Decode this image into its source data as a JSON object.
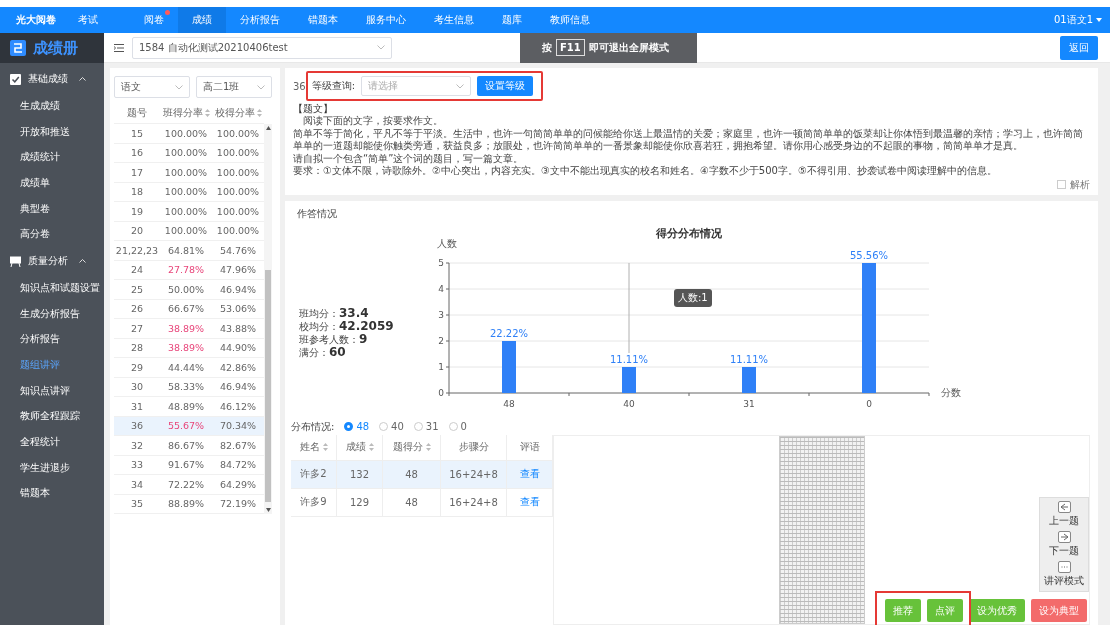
{
  "top_nav": {
    "brand": "光大阅卷",
    "items": [
      {
        "label": "考试",
        "selected": false,
        "dot": false
      },
      {
        "label": "阅卷",
        "selected": false,
        "dot": true
      },
      {
        "label": "成绩",
        "selected": true,
        "dot": false
      },
      {
        "label": "分析报告",
        "selected": false,
        "dot": false
      },
      {
        "label": "错题本",
        "selected": false,
        "dot": false
      },
      {
        "label": "服务中心",
        "selected": false,
        "dot": false
      },
      {
        "label": "考生信息",
        "selected": false,
        "dot": false
      },
      {
        "label": "题库",
        "selected": false,
        "dot": false
      },
      {
        "label": "教师信息",
        "selected": false,
        "dot": false
      }
    ],
    "user": "01语文1"
  },
  "sidebar": {
    "title": "成绩册",
    "groups": [
      {
        "label": "基础成绩",
        "expanded": true,
        "children": [
          {
            "label": "生成成绩",
            "selected": false
          },
          {
            "label": "开放和推送",
            "selected": false
          },
          {
            "label": "成绩统计",
            "selected": false
          },
          {
            "label": "成绩单",
            "selected": false
          },
          {
            "label": "典型卷",
            "selected": false
          },
          {
            "label": "高分卷",
            "selected": false
          }
        ]
      },
      {
        "label": "质量分析",
        "expanded": true,
        "children": [
          {
            "label": "知识点和试题设置",
            "selected": false
          },
          {
            "label": "生成分析报告",
            "selected": false
          },
          {
            "label": "分析报告",
            "selected": false
          },
          {
            "label": "题组讲评",
            "selected": true
          },
          {
            "label": "知识点讲评",
            "selected": false
          },
          {
            "label": "教师全程跟踪",
            "selected": false
          },
          {
            "label": "全程统计",
            "selected": false
          },
          {
            "label": "学生进退步",
            "selected": false
          },
          {
            "label": "错题本",
            "selected": false
          }
        ]
      }
    ]
  },
  "toolbar": {
    "exam_select": "1584 自动化测试20210406test",
    "fullscreen_banner": {
      "before": "按",
      "key": "F11",
      "after": "即可退出全屏模式"
    },
    "back_button": "返回"
  },
  "question_panel": {
    "subject_select": "语文",
    "class_select": "高二1班",
    "columns": [
      "题号",
      "班得分率",
      "校得分率"
    ],
    "rows": [
      {
        "cells": [
          "15",
          "100.00%",
          "100.00%"
        ],
        "low": false,
        "selected": false
      },
      {
        "cells": [
          "16",
          "100.00%",
          "100.00%"
        ],
        "low": false,
        "selected": false
      },
      {
        "cells": [
          "17",
          "100.00%",
          "100.00%"
        ],
        "low": false,
        "selected": false
      },
      {
        "cells": [
          "18",
          "100.00%",
          "100.00%"
        ],
        "low": false,
        "selected": false
      },
      {
        "cells": [
          "19",
          "100.00%",
          "100.00%"
        ],
        "low": false,
        "selected": false
      },
      {
        "cells": [
          "20",
          "100.00%",
          "100.00%"
        ],
        "low": false,
        "selected": false
      },
      {
        "cells": [
          "21,22,23",
          "64.81%",
          "54.76%"
        ],
        "low": false,
        "selected": false
      },
      {
        "cells": [
          "24",
          "27.78%",
          "47.96%"
        ],
        "low": true,
        "selected": false
      },
      {
        "cells": [
          "25",
          "50.00%",
          "46.94%"
        ],
        "low": false,
        "selected": false
      },
      {
        "cells": [
          "26",
          "66.67%",
          "53.06%"
        ],
        "low": false,
        "selected": false
      },
      {
        "cells": [
          "27",
          "38.89%",
          "43.88%"
        ],
        "low": true,
        "selected": false
      },
      {
        "cells": [
          "28",
          "38.89%",
          "44.90%"
        ],
        "low": true,
        "selected": false
      },
      {
        "cells": [
          "29",
          "44.44%",
          "42.86%"
        ],
        "low": false,
        "selected": false
      },
      {
        "cells": [
          "30",
          "58.33%",
          "46.94%"
        ],
        "low": false,
        "selected": false
      },
      {
        "cells": [
          "31",
          "48.89%",
          "46.12%"
        ],
        "low": false,
        "selected": false
      },
      {
        "cells": [
          "36",
          "55.67%",
          "70.34%"
        ],
        "low": true,
        "selected": true
      },
      {
        "cells": [
          "32",
          "86.67%",
          "82.67%"
        ],
        "low": false,
        "selected": false
      },
      {
        "cells": [
          "33",
          "91.67%",
          "84.72%"
        ],
        "low": false,
        "selected": false
      },
      {
        "cells": [
          "34",
          "72.22%",
          "64.29%"
        ],
        "low": false,
        "selected": false
      },
      {
        "cells": [
          "35",
          "88.89%",
          "72.19%"
        ],
        "low": false,
        "selected": false
      }
    ]
  },
  "question_card": {
    "number": "36",
    "grade_label": "等级查询:",
    "grade_placeholder": "请选择",
    "grade_button": "设置等级",
    "heading": "【题文】",
    "paragraphs": [
      "阅读下面的文字，按要求作文。",
      "简单不等于简化，平凡不等于平淡。生活中，也许一句简简单单的问候能给你送上最温情的关爱；家庭里，也许一顿简简单单的饭菜却让你体悟到最温馨的亲情；学习上，也许简简单单的一道题却能使你触类旁通，获益良多；放眼处，也许简简单单的一番景象却能使你欣喜若狂，拥抱希望。请你用心感受身边的不起眼的事物，简简单单才是真。",
      "请自拟一个包含“简单”这个词的题目，写一篇文章。",
      "要求：①文体不限，诗歌除外。②中心突出，内容充实。③文中不能出现真实的校名和姓名。④字数不少于500字。⑤不得引用、抄袭试卷中阅读理解中的信息。"
    ],
    "analysis": {
      "label": "解析",
      "checked": false
    }
  },
  "answer_card": {
    "title": "作答情况",
    "stats": [
      {
        "label": "班均分：",
        "value": "33.4"
      },
      {
        "label": "校均分：",
        "value": "42.2059"
      },
      {
        "label": "班参考人数：",
        "value": "9"
      },
      {
        "label": "满分：",
        "value": "60"
      }
    ],
    "chart_data": {
      "type": "bar",
      "title": "得分分布情况",
      "xlabel": "分数",
      "ylabel": "人数",
      "categories": [
        "48",
        "40",
        "31",
        "0"
      ],
      "series": [
        {
          "color": "#2f80f7",
          "values": [
            2,
            1,
            1,
            5
          ]
        }
      ],
      "grid": true,
      "annotations": [
        "人数:1"
      ],
      "ylim": [
        0,
        5
      ],
      "yticks": [
        0,
        1,
        2,
        3,
        4,
        5
      ],
      "value_labels": [
        "22.22%",
        "11.11%",
        "11.11%",
        "55.56%"
      ]
    },
    "distribution": {
      "label": "分布情况:",
      "options": [
        {
          "label": "48",
          "selected": true
        },
        {
          "label": "40",
          "selected": false
        },
        {
          "label": "31",
          "selected": false
        },
        {
          "label": "0",
          "selected": false
        }
      ]
    },
    "students": {
      "columns": [
        {
          "label": "姓名",
          "sortable": true
        },
        {
          "label": "成绩",
          "sortable": true
        },
        {
          "label": "题得分",
          "sortable": true
        },
        {
          "label": "步骤分",
          "sortable": false
        },
        {
          "label": "评语",
          "sortable": false
        }
      ],
      "rows": [
        {
          "cells": [
            "许多2",
            "132",
            "48",
            "16+24+8"
          ],
          "link": "查看",
          "selected": true
        },
        {
          "cells": [
            "许多9",
            "129",
            "48",
            "16+24+8"
          ],
          "link": "查看",
          "selected": false
        }
      ]
    },
    "actions": [
      {
        "label": "推荐",
        "kind": "green"
      },
      {
        "label": "点评",
        "kind": "green"
      },
      {
        "label": "设为优秀",
        "kind": "green"
      },
      {
        "label": "设为典型",
        "kind": "red"
      }
    ],
    "side_tools": [
      {
        "label": "上一题"
      },
      {
        "label": "下一题"
      },
      {
        "label": "讲评模式"
      }
    ]
  }
}
